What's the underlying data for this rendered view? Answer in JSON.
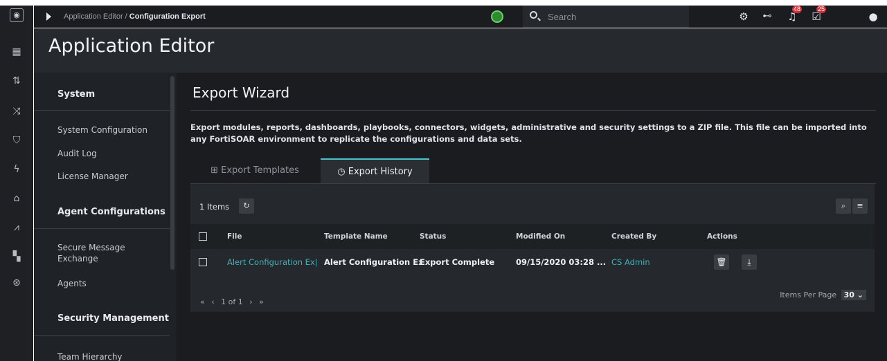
{
  "rail": {
    "icons": [
      "logo-icon",
      "dashboard-grid-icon",
      "modules-icon",
      "shuffle-icon",
      "shield-icon",
      "bolt-icon",
      "building-icon",
      "chart-icon",
      "apps-icon",
      "help-icon"
    ]
  },
  "topbar": {
    "breadcrumb_parent": "Application Editor",
    "breadcrumb_separator": "/",
    "breadcrumb_current": "Configuration Export",
    "search_placeholder": "Search",
    "notifications_count": "48",
    "tasks_count": "25"
  },
  "header": {
    "title": "Application Editor"
  },
  "sidebar": {
    "sections": [
      {
        "title": "System",
        "items": [
          "System Configuration",
          "Audit Log",
          "License Manager"
        ]
      },
      {
        "title": "Agent Configurations",
        "items": [
          "Secure Message Exchange",
          "Agents"
        ]
      },
      {
        "title": "Security Management",
        "items": [
          "Team Hierarchy"
        ]
      }
    ]
  },
  "main": {
    "wizard_title": "Export Wizard",
    "description": "Export modules, reports, dashboards, playbooks, connectors, widgets, administrative and security settings to a ZIP file. This file can be imported into any FortiSOAR environment to replicate the configurations and data sets.",
    "tabs": [
      {
        "label": "Export Templates",
        "icon": "template-icon",
        "active": false
      },
      {
        "label": "Export History",
        "icon": "history-icon",
        "active": true
      }
    ],
    "items_count": "1 Items",
    "table": {
      "columns": [
        "File",
        "Template Name",
        "Status",
        "Modified On",
        "Created By",
        "Actions"
      ],
      "rows": [
        {
          "file": "Alert Configuration Ex|",
          "template_name": "Alert Configuration Ex|",
          "status": "Export Complete",
          "modified_on": "09/15/2020 03:28 ...",
          "created_by": "CS Admin"
        }
      ]
    },
    "pagination": {
      "page_text": "1 of 1",
      "items_per_page_label": "Items Per Page",
      "items_per_page": "30"
    }
  },
  "colors": {
    "accent": "#4ec3c9",
    "link": "#3fb1b8",
    "badge": "#d0303a"
  }
}
